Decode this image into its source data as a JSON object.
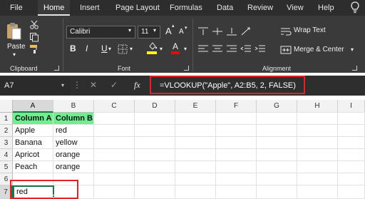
{
  "tabs": [
    {
      "label": "File",
      "active": false
    },
    {
      "label": "Home",
      "active": true
    },
    {
      "label": "Insert",
      "active": false
    },
    {
      "label": "Page Layout",
      "active": false
    },
    {
      "label": "Formulas",
      "active": false
    },
    {
      "label": "Data",
      "active": false
    },
    {
      "label": "Review",
      "active": false
    },
    {
      "label": "View",
      "active": false
    },
    {
      "label": "Help",
      "active": false
    }
  ],
  "tell_me_icon": "lightbulb-icon",
  "ribbon": {
    "clipboard": {
      "label": "Clipboard",
      "paste_label": "Paste"
    },
    "font": {
      "label": "Font",
      "font_name": "Calibri",
      "font_size": "11",
      "grow_glyph": "A",
      "shrink_glyph": "A",
      "bold": "B",
      "italic": "I",
      "underline": "U",
      "font_color_glyph": "A",
      "fill_color": "#ffff00",
      "font_color": "#ff0000"
    },
    "alignment": {
      "label": "Alignment",
      "wrap_text": "Wrap Text",
      "merge_center": "Merge & Center"
    }
  },
  "formula_bar": {
    "name_box": "A7",
    "fx": "fx",
    "formula": "=VLOOKUP(\"Apple\", A2:B5, 2, FALSE)"
  },
  "grid": {
    "columns": [
      "A",
      "B",
      "C",
      "D",
      "E",
      "F",
      "G",
      "H",
      "I"
    ],
    "rows": [
      "1",
      "2",
      "3",
      "4",
      "5",
      "6",
      "7"
    ],
    "cells": {
      "A1": "Column A",
      "B1": "Column B",
      "A2": "Apple",
      "B2": "red",
      "A3": "Banana",
      "B3": "yellow",
      "A4": "Apricot",
      "B4": "orange",
      "A5": "Peach",
      "B5": "orange",
      "A7": "red"
    },
    "active_cell": "A7"
  },
  "colors": {
    "header_fill": "#6cef8e",
    "highlight_border": "#e32227",
    "selection": "#217346"
  }
}
